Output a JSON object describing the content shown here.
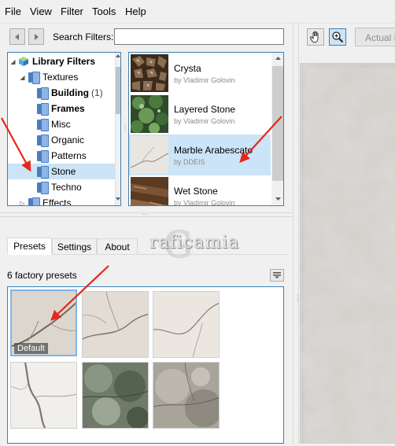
{
  "menu": [
    "File",
    "View",
    "Filter",
    "Tools",
    "Help"
  ],
  "toolbar": {
    "search_label": "Search Filters:",
    "search_value": "",
    "back_icon": "arrow-left-icon",
    "forward_icon": "arrow-right-icon"
  },
  "tree": {
    "root": "Library Filters",
    "items": [
      {
        "label": "Textures",
        "count": "",
        "bold": false
      },
      {
        "label": "Building",
        "count": "(1)",
        "bold": true
      },
      {
        "label": "Frames",
        "count": "",
        "bold": false
      },
      {
        "label": "Misc",
        "count": "",
        "bold": false
      },
      {
        "label": "Organic",
        "count": "",
        "bold": false
      },
      {
        "label": "Patterns",
        "count": "",
        "bold": false
      },
      {
        "label": "Stone",
        "count": "",
        "bold": false,
        "selected": true
      },
      {
        "label": "Techno",
        "count": "",
        "bold": false
      },
      {
        "label": "Effects",
        "count": "",
        "bold": false
      }
    ]
  },
  "filters": [
    {
      "name": "Crysta",
      "author": "by Vladimir Golovin"
    },
    {
      "name": "Layered Stone",
      "author": "by Vladimir Golovin"
    },
    {
      "name": "Marble Arabescato",
      "author": "by DDEIS",
      "selected": true
    },
    {
      "name": "Wet Stone",
      "author": "by Vladimir Golovin"
    }
  ],
  "tabs": [
    "Presets",
    "Settings",
    "About"
  ],
  "active_tab": "Presets",
  "presets": {
    "count_label": "6 factory presets",
    "default_label": "Default"
  },
  "right": {
    "hand_icon": "hand-pan-icon",
    "zoom_icon": "zoom-in-icon",
    "actual_label": "Actual Pixels"
  },
  "watermark": {
    "letter": "G",
    "text": "raficamia"
  },
  "colors": {
    "selection": "#cce4f7",
    "border_focus": "#3c7fb1",
    "arrow": "#e8261b"
  }
}
